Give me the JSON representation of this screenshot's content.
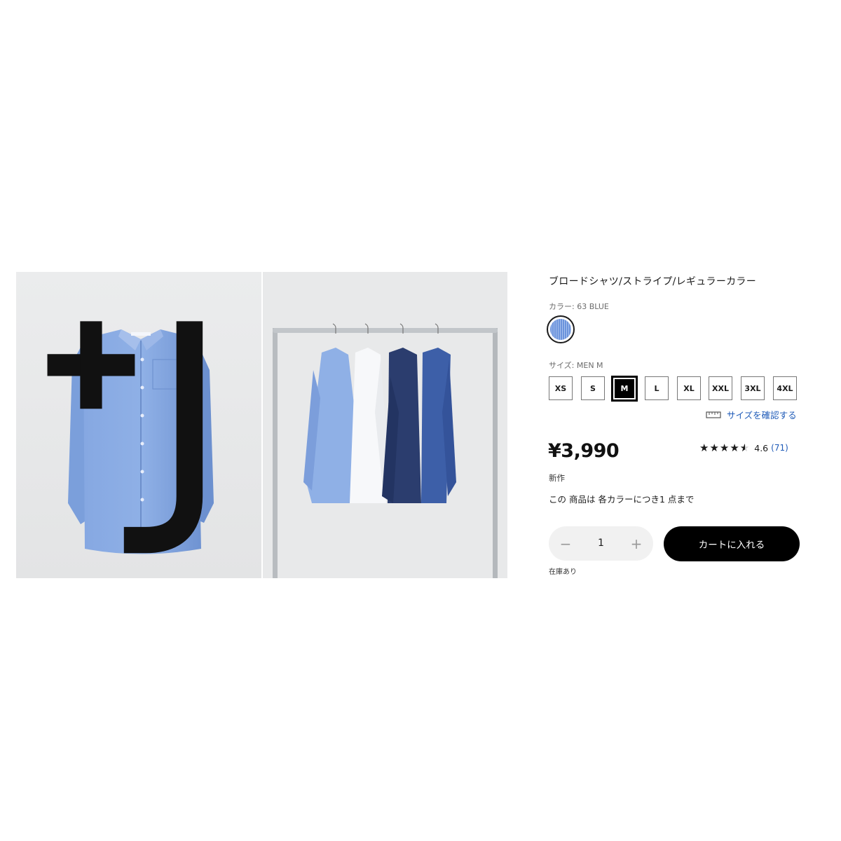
{
  "product": {
    "title": "ブロードシャツ/ストライプ/レギュラーカラー",
    "brand_mark": "+J",
    "color_label": "カラー: 63 BLUE",
    "color_swatch_icon": "blue-stripe-swatch",
    "size_label": "サイズ: MEN M",
    "sizes": [
      "XS",
      "S",
      "M",
      "L",
      "XL",
      "XXL",
      "3XL",
      "4XL"
    ],
    "selected_size": "M",
    "size_guide_label": "サイズを確認する",
    "size_guide_icon": "ruler-icon",
    "price": "¥3,990",
    "rating": {
      "stars": "★★★★",
      "half_star": "★",
      "value": "4.6",
      "count": "(71)"
    },
    "badge_new": "新作",
    "purchase_limit": "この 商品は 各カラーにつき1 点まで",
    "quantity": {
      "minus": "−",
      "value": "1",
      "plus": "+"
    },
    "add_to_cart": "カートに入れる",
    "stock_status": "在庫あり"
  },
  "colors": {
    "accent_link": "#1f5bb8",
    "cart_button": "#000000",
    "shirt_blue": "#7fa3de"
  }
}
